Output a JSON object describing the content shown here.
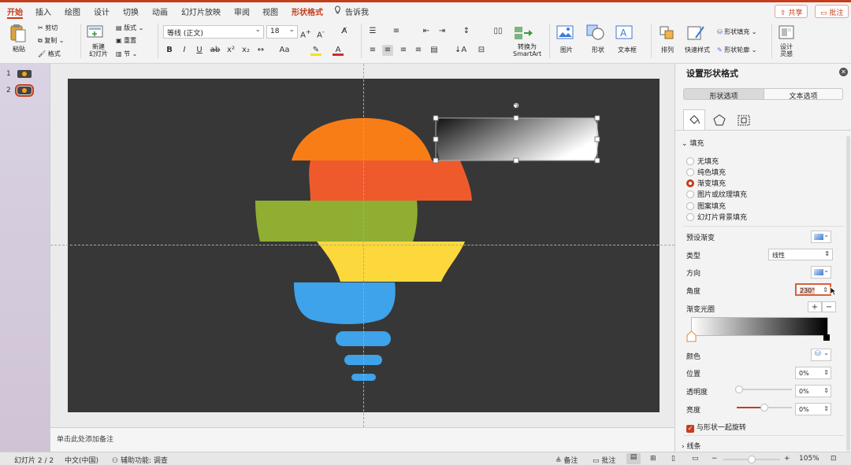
{
  "menu": {
    "tabs": [
      "开始",
      "插入",
      "绘图",
      "设计",
      "切换",
      "动画",
      "幻灯片放映",
      "审阅",
      "视图",
      "形状格式",
      "告诉我"
    ],
    "share_label": "共享",
    "comment_label": "批注"
  },
  "ribbon": {
    "paste": "粘贴",
    "cut": "剪切",
    "copy": "复制",
    "format_painter": "格式",
    "new_slide": "新建\n幻灯片",
    "layout": "版式",
    "reset": "重置",
    "section": "节",
    "font_name": "等线 (正文)",
    "font_size": "18",
    "convert_smartart": "转换为\nSmartArt",
    "picture": "图片",
    "shape": "形状",
    "textbox": "文本框",
    "arrange": "排列",
    "quick_styles": "快速样式",
    "shape_fill": "形状填充",
    "shape_outline": "形状轮廓",
    "designer": "设计\n灵感"
  },
  "thumbnails": [
    {
      "number": "1",
      "selected": false
    },
    {
      "number": "2",
      "selected": true
    }
  ],
  "notes_placeholder": "单击此处添加备注",
  "slide": {
    "background": "#373737",
    "bulb_colors": [
      "#f97d16",
      "#ef5a2d",
      "#8fae32",
      "#fcd83c",
      "#3ea3ea",
      "#3ea3ea",
      "#3ea3ea",
      "#3ea3ea"
    ]
  },
  "panel": {
    "title": "设置形状格式",
    "tabs": [
      "形状选项",
      "文本选项"
    ],
    "section_fill": "填充",
    "fill_options": [
      "无填充",
      "纯色填充",
      "渐变填充",
      "图片或纹理填充",
      "图案填充",
      "幻灯片背景填充"
    ],
    "selected_fill": 2,
    "preset_gradient": "预设渐变",
    "type_label": "类型",
    "type_value": "线性",
    "direction_label": "方向",
    "angle_label": "角度",
    "angle_value": "230°",
    "gradient_stops_label": "渐变光圈",
    "color_label": "颜色",
    "position_label": "位置",
    "position_value": "0%",
    "transparency_label": "透明度",
    "transparency_value": "0%",
    "brightness_label": "亮度",
    "brightness_value": "0%",
    "rotate_with_shape": "与形状一起旋转",
    "section_line": "线条"
  },
  "statusbar": {
    "slide_count": "幻灯片 2 / 2",
    "language": "中文(中国)",
    "accessibility": "辅助功能: 调查",
    "notes": "备注",
    "comments": "批注",
    "zoom": "105%"
  },
  "colors": {
    "accent": "#c43e1c"
  }
}
